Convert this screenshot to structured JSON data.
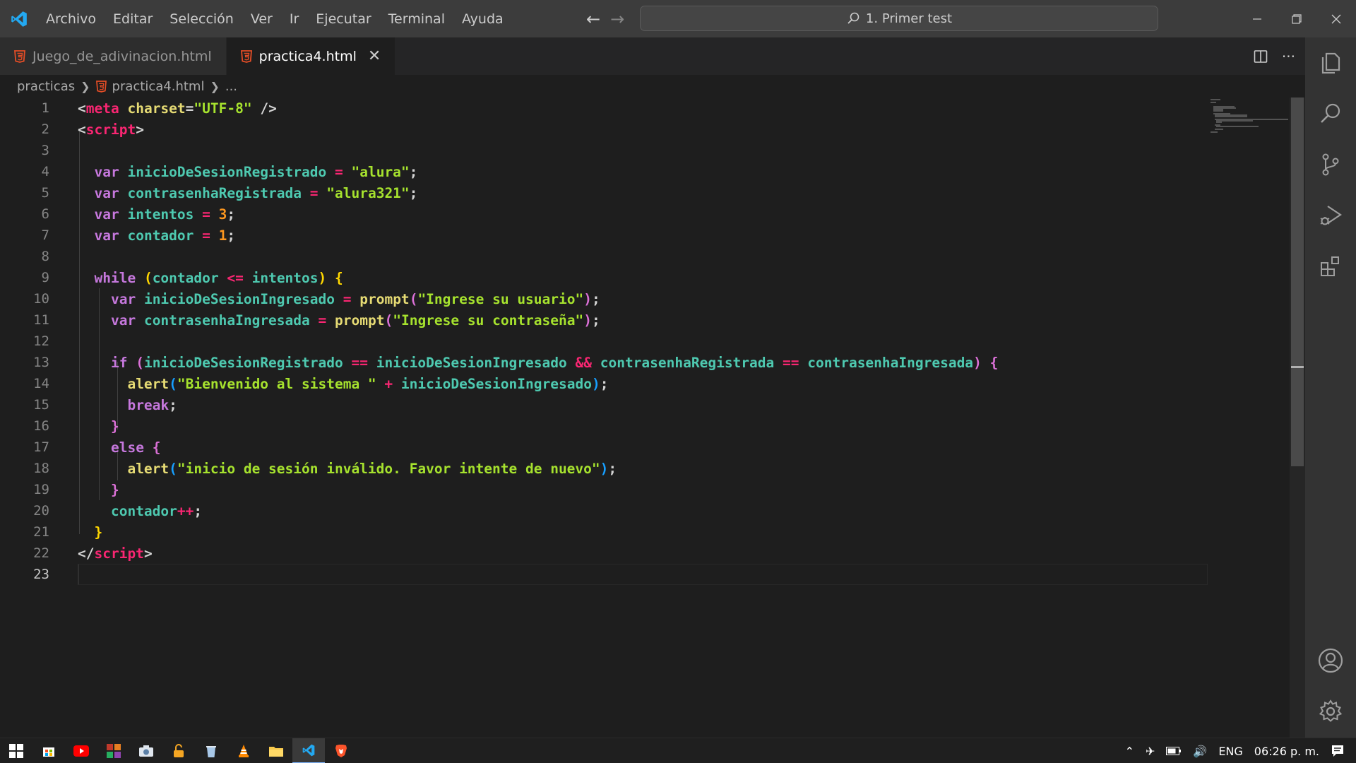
{
  "titlebar": {
    "menu": [
      "Archivo",
      "Editar",
      "Selección",
      "Ver",
      "Ir",
      "Ejecutar",
      "Terminal",
      "Ayuda"
    ],
    "search_text": "1. Primer test"
  },
  "tabs": [
    {
      "label": "Juego_de_adivinacion.html",
      "active": false
    },
    {
      "label": "practica4.html",
      "active": true
    }
  ],
  "breadcrumb": {
    "folder": "practicas",
    "file": "practica4.html",
    "more": "..."
  },
  "editor": {
    "current_line": 23,
    "lines": [
      {
        "n": "1"
      },
      {
        "n": "2"
      },
      {
        "n": "3"
      },
      {
        "n": "4"
      },
      {
        "n": "5"
      },
      {
        "n": "6"
      },
      {
        "n": "7"
      },
      {
        "n": "8"
      },
      {
        "n": "9"
      },
      {
        "n": "10"
      },
      {
        "n": "11"
      },
      {
        "n": "12"
      },
      {
        "n": "13"
      },
      {
        "n": "14"
      },
      {
        "n": "15"
      },
      {
        "n": "16"
      },
      {
        "n": "17"
      },
      {
        "n": "18"
      },
      {
        "n": "19"
      },
      {
        "n": "20"
      },
      {
        "n": "21"
      },
      {
        "n": "22"
      },
      {
        "n": "23"
      }
    ],
    "code": [
      [
        [
          "punc",
          "<"
        ],
        [
          "tag",
          "meta"
        ],
        [
          "punc",
          " "
        ],
        [
          "attr",
          "charset"
        ],
        [
          "punc",
          "="
        ],
        [
          "str",
          "\"UTF-8\""
        ],
        [
          "punc",
          " />"
        ]
      ],
      [
        [
          "punc",
          "<"
        ],
        [
          "tag",
          "script"
        ],
        [
          "punc",
          ">"
        ]
      ],
      [],
      [
        [
          "punc",
          "  "
        ],
        [
          "kw",
          "var"
        ],
        [
          "punc",
          " "
        ],
        [
          "var",
          "inicioDeSesionRegistrado"
        ],
        [
          "punc",
          " "
        ],
        [
          "op",
          "="
        ],
        [
          "punc",
          " "
        ],
        [
          "str",
          "\"alura\""
        ],
        [
          "punc",
          ";"
        ]
      ],
      [
        [
          "punc",
          "  "
        ],
        [
          "kw",
          "var"
        ],
        [
          "punc",
          " "
        ],
        [
          "var",
          "contrasenhaRegistrada"
        ],
        [
          "punc",
          " "
        ],
        [
          "op",
          "="
        ],
        [
          "punc",
          " "
        ],
        [
          "str",
          "\"alura321\""
        ],
        [
          "punc",
          ";"
        ]
      ],
      [
        [
          "punc",
          "  "
        ],
        [
          "kw",
          "var"
        ],
        [
          "punc",
          " "
        ],
        [
          "var",
          "intentos"
        ],
        [
          "punc",
          " "
        ],
        [
          "op",
          "="
        ],
        [
          "punc",
          " "
        ],
        [
          "num",
          "3"
        ],
        [
          "punc",
          ";"
        ]
      ],
      [
        [
          "punc",
          "  "
        ],
        [
          "kw",
          "var"
        ],
        [
          "punc",
          " "
        ],
        [
          "var",
          "contador"
        ],
        [
          "punc",
          " "
        ],
        [
          "op",
          "="
        ],
        [
          "punc",
          " "
        ],
        [
          "num",
          "1"
        ],
        [
          "punc",
          ";"
        ]
      ],
      [],
      [
        [
          "punc",
          "  "
        ],
        [
          "kw",
          "while"
        ],
        [
          "punc",
          " "
        ],
        [
          "brace1",
          "("
        ],
        [
          "var",
          "contador"
        ],
        [
          "punc",
          " "
        ],
        [
          "op",
          "<="
        ],
        [
          "punc",
          " "
        ],
        [
          "var",
          "intentos"
        ],
        [
          "brace1",
          ")"
        ],
        [
          "punc",
          " "
        ],
        [
          "brace1",
          "{"
        ]
      ],
      [
        [
          "punc",
          "    "
        ],
        [
          "kw",
          "var"
        ],
        [
          "punc",
          " "
        ],
        [
          "var",
          "inicioDeSesionIngresado"
        ],
        [
          "punc",
          " "
        ],
        [
          "op",
          "="
        ],
        [
          "punc",
          " "
        ],
        [
          "fn",
          "prompt"
        ],
        [
          "brace2",
          "("
        ],
        [
          "str",
          "\"Ingrese su usuario\""
        ],
        [
          "brace2",
          ")"
        ],
        [
          "punc",
          ";"
        ]
      ],
      [
        [
          "punc",
          "    "
        ],
        [
          "kw",
          "var"
        ],
        [
          "punc",
          " "
        ],
        [
          "var",
          "contrasenhaIngresada"
        ],
        [
          "punc",
          " "
        ],
        [
          "op",
          "="
        ],
        [
          "punc",
          " "
        ],
        [
          "fn",
          "prompt"
        ],
        [
          "brace2",
          "("
        ],
        [
          "str",
          "\"Ingrese su contraseña\""
        ],
        [
          "brace2",
          ")"
        ],
        [
          "punc",
          ";"
        ]
      ],
      [],
      [
        [
          "punc",
          "    "
        ],
        [
          "kw",
          "if"
        ],
        [
          "punc",
          " "
        ],
        [
          "brace2",
          "("
        ],
        [
          "var",
          "inicioDeSesionRegistrado"
        ],
        [
          "punc",
          " "
        ],
        [
          "op",
          "=="
        ],
        [
          "punc",
          " "
        ],
        [
          "var",
          "inicioDeSesionIngresado"
        ],
        [
          "punc",
          " "
        ],
        [
          "op",
          "&&"
        ],
        [
          "punc",
          " "
        ],
        [
          "var",
          "contrasenhaRegistrada"
        ],
        [
          "punc",
          " "
        ],
        [
          "op",
          "=="
        ],
        [
          "punc",
          " "
        ],
        [
          "var",
          "contrasenhaIngresada"
        ],
        [
          "brace2",
          ")"
        ],
        [
          "punc",
          " "
        ],
        [
          "brace2",
          "{"
        ]
      ],
      [
        [
          "punc",
          "      "
        ],
        [
          "fn",
          "alert"
        ],
        [
          "paren",
          "("
        ],
        [
          "str",
          "\"Bienvenido al sistema \""
        ],
        [
          "punc",
          " "
        ],
        [
          "op",
          "+"
        ],
        [
          "punc",
          " "
        ],
        [
          "var",
          "inicioDeSesionIngresado"
        ],
        [
          "paren",
          ")"
        ],
        [
          "punc",
          ";"
        ]
      ],
      [
        [
          "punc",
          "      "
        ],
        [
          "kw",
          "break"
        ],
        [
          "punc",
          ";"
        ]
      ],
      [
        [
          "punc",
          "    "
        ],
        [
          "brace2",
          "}"
        ]
      ],
      [
        [
          "punc",
          "    "
        ],
        [
          "kw",
          "else"
        ],
        [
          "punc",
          " "
        ],
        [
          "brace2",
          "{"
        ]
      ],
      [
        [
          "punc",
          "      "
        ],
        [
          "fn",
          "alert"
        ],
        [
          "paren",
          "("
        ],
        [
          "str",
          "\"inicio de sesión inválido. Favor intente de nuevo\""
        ],
        [
          "paren",
          ")"
        ],
        [
          "punc",
          ";"
        ]
      ],
      [
        [
          "punc",
          "    "
        ],
        [
          "brace2",
          "}"
        ]
      ],
      [
        [
          "punc",
          "    "
        ],
        [
          "var",
          "contador"
        ],
        [
          "op",
          "++"
        ],
        [
          "punc",
          ";"
        ]
      ],
      [
        [
          "punc",
          "  "
        ],
        [
          "brace1",
          "}"
        ]
      ],
      [
        [
          "punc",
          "</"
        ],
        [
          "tag",
          "script"
        ],
        [
          "punc",
          ">"
        ]
      ],
      []
    ]
  },
  "taskbar": {
    "language": "ENG",
    "time": "06:26 p. m."
  },
  "colors": {
    "titlebar": "#3c3c3c",
    "editor_bg": "#1e1e1e",
    "html_icon": "#e44d26",
    "vscode_blue": "#23a9f2"
  }
}
